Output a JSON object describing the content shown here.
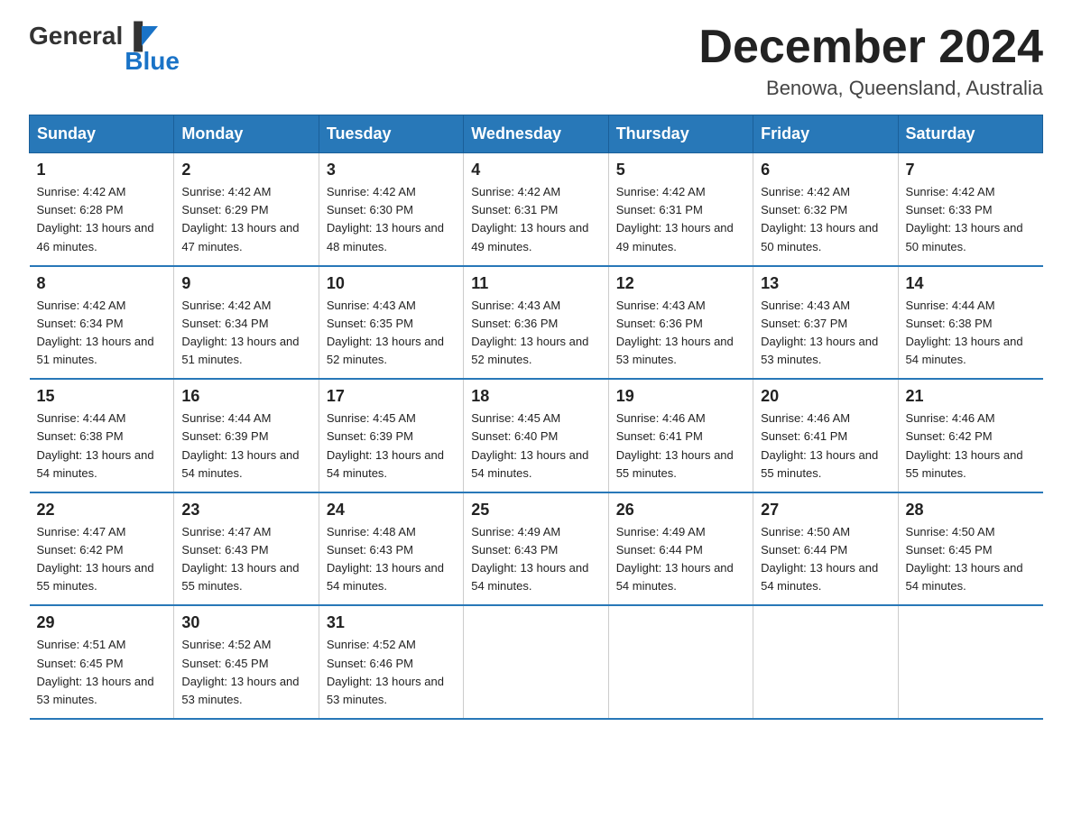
{
  "logo": {
    "general": "General",
    "blue": "Blue"
  },
  "title": "December 2024",
  "location": "Benowa, Queensland, Australia",
  "days_of_week": [
    "Sunday",
    "Monday",
    "Tuesday",
    "Wednesday",
    "Thursday",
    "Friday",
    "Saturday"
  ],
  "weeks": [
    [
      {
        "date": "1",
        "sunrise": "4:42 AM",
        "sunset": "6:28 PM",
        "daylight": "13 hours and 46 minutes."
      },
      {
        "date": "2",
        "sunrise": "4:42 AM",
        "sunset": "6:29 PM",
        "daylight": "13 hours and 47 minutes."
      },
      {
        "date": "3",
        "sunrise": "4:42 AM",
        "sunset": "6:30 PM",
        "daylight": "13 hours and 48 minutes."
      },
      {
        "date": "4",
        "sunrise": "4:42 AM",
        "sunset": "6:31 PM",
        "daylight": "13 hours and 49 minutes."
      },
      {
        "date": "5",
        "sunrise": "4:42 AM",
        "sunset": "6:31 PM",
        "daylight": "13 hours and 49 minutes."
      },
      {
        "date": "6",
        "sunrise": "4:42 AM",
        "sunset": "6:32 PM",
        "daylight": "13 hours and 50 minutes."
      },
      {
        "date": "7",
        "sunrise": "4:42 AM",
        "sunset": "6:33 PM",
        "daylight": "13 hours and 50 minutes."
      }
    ],
    [
      {
        "date": "8",
        "sunrise": "4:42 AM",
        "sunset": "6:34 PM",
        "daylight": "13 hours and 51 minutes."
      },
      {
        "date": "9",
        "sunrise": "4:42 AM",
        "sunset": "6:34 PM",
        "daylight": "13 hours and 51 minutes."
      },
      {
        "date": "10",
        "sunrise": "4:43 AM",
        "sunset": "6:35 PM",
        "daylight": "13 hours and 52 minutes."
      },
      {
        "date": "11",
        "sunrise": "4:43 AM",
        "sunset": "6:36 PM",
        "daylight": "13 hours and 52 minutes."
      },
      {
        "date": "12",
        "sunrise": "4:43 AM",
        "sunset": "6:36 PM",
        "daylight": "13 hours and 53 minutes."
      },
      {
        "date": "13",
        "sunrise": "4:43 AM",
        "sunset": "6:37 PM",
        "daylight": "13 hours and 53 minutes."
      },
      {
        "date": "14",
        "sunrise": "4:44 AM",
        "sunset": "6:38 PM",
        "daylight": "13 hours and 54 minutes."
      }
    ],
    [
      {
        "date": "15",
        "sunrise": "4:44 AM",
        "sunset": "6:38 PM",
        "daylight": "13 hours and 54 minutes."
      },
      {
        "date": "16",
        "sunrise": "4:44 AM",
        "sunset": "6:39 PM",
        "daylight": "13 hours and 54 minutes."
      },
      {
        "date": "17",
        "sunrise": "4:45 AM",
        "sunset": "6:39 PM",
        "daylight": "13 hours and 54 minutes."
      },
      {
        "date": "18",
        "sunrise": "4:45 AM",
        "sunset": "6:40 PM",
        "daylight": "13 hours and 54 minutes."
      },
      {
        "date": "19",
        "sunrise": "4:46 AM",
        "sunset": "6:41 PM",
        "daylight": "13 hours and 55 minutes."
      },
      {
        "date": "20",
        "sunrise": "4:46 AM",
        "sunset": "6:41 PM",
        "daylight": "13 hours and 55 minutes."
      },
      {
        "date": "21",
        "sunrise": "4:46 AM",
        "sunset": "6:42 PM",
        "daylight": "13 hours and 55 minutes."
      }
    ],
    [
      {
        "date": "22",
        "sunrise": "4:47 AM",
        "sunset": "6:42 PM",
        "daylight": "13 hours and 55 minutes."
      },
      {
        "date": "23",
        "sunrise": "4:47 AM",
        "sunset": "6:43 PM",
        "daylight": "13 hours and 55 minutes."
      },
      {
        "date": "24",
        "sunrise": "4:48 AM",
        "sunset": "6:43 PM",
        "daylight": "13 hours and 54 minutes."
      },
      {
        "date": "25",
        "sunrise": "4:49 AM",
        "sunset": "6:43 PM",
        "daylight": "13 hours and 54 minutes."
      },
      {
        "date": "26",
        "sunrise": "4:49 AM",
        "sunset": "6:44 PM",
        "daylight": "13 hours and 54 minutes."
      },
      {
        "date": "27",
        "sunrise": "4:50 AM",
        "sunset": "6:44 PM",
        "daylight": "13 hours and 54 minutes."
      },
      {
        "date": "28",
        "sunrise": "4:50 AM",
        "sunset": "6:45 PM",
        "daylight": "13 hours and 54 minutes."
      }
    ],
    [
      {
        "date": "29",
        "sunrise": "4:51 AM",
        "sunset": "6:45 PM",
        "daylight": "13 hours and 53 minutes."
      },
      {
        "date": "30",
        "sunrise": "4:52 AM",
        "sunset": "6:45 PM",
        "daylight": "13 hours and 53 minutes."
      },
      {
        "date": "31",
        "sunrise": "4:52 AM",
        "sunset": "6:46 PM",
        "daylight": "13 hours and 53 minutes."
      },
      null,
      null,
      null,
      null
    ]
  ]
}
